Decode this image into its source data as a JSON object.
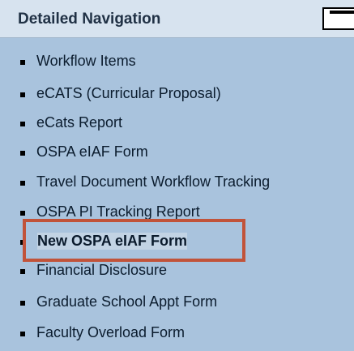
{
  "panel": {
    "title": "Detailed Navigation",
    "collapse_icon": "minus-icon"
  },
  "nav": {
    "items": [
      {
        "label": "Workflow Items",
        "selected": false
      },
      {
        "label": "eCATS (Curricular Proposal)",
        "selected": false
      },
      {
        "label": "eCats Report",
        "selected": false
      },
      {
        "label": "OSPA eIAF Form",
        "selected": false
      },
      {
        "label": "Travel Document Workflow Tracking",
        "selected": false
      },
      {
        "label": "OSPA PI Tracking Report",
        "selected": false
      },
      {
        "label": "New OSPA eIAF Form",
        "selected": true
      },
      {
        "label": "Financial Disclosure",
        "selected": false
      },
      {
        "label": "Graduate School Appt Form",
        "selected": false
      },
      {
        "label": "Faculty Overload Form",
        "selected": false
      }
    ]
  },
  "colors": {
    "panel_background": "#a9c3dd",
    "header_background": "#d7e3ef",
    "highlight_border": "#c1533a"
  }
}
